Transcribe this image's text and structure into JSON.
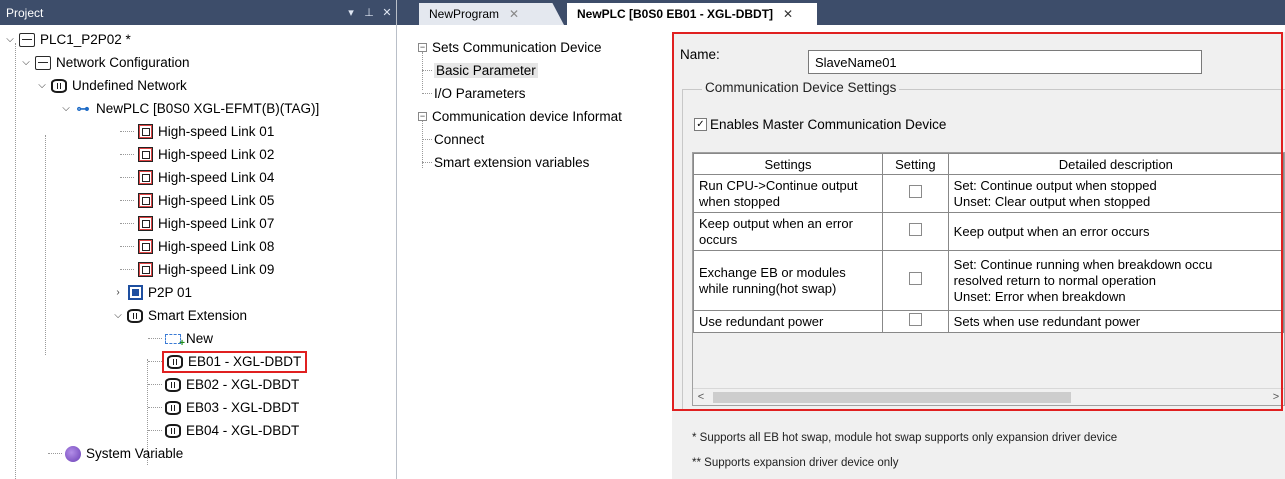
{
  "project_panel": {
    "title": "Project",
    "buttons": [
      "▾",
      "ᵖ",
      "✕"
    ],
    "tree": [
      {
        "label": "PLC1_P2P02 *"
      },
      {
        "label": "Network Configuration"
      },
      {
        "label": "Undefined Network"
      },
      {
        "label": "NewPLC [B0S0 XGL-EFMT(B)(TAG)]"
      },
      {
        "label": "High-speed Link 01"
      },
      {
        "label": "High-speed Link 02"
      },
      {
        "label": "High-speed Link 04"
      },
      {
        "label": "High-speed Link 05"
      },
      {
        "label": "High-speed Link 07"
      },
      {
        "label": "High-speed Link 08"
      },
      {
        "label": "High-speed Link 09"
      },
      {
        "label": "P2P 01"
      },
      {
        "label": "Smart Extension"
      },
      {
        "label": "New"
      },
      {
        "label": "EB01 - XGL-DBDT"
      },
      {
        "label": "EB02 - XGL-DBDT"
      },
      {
        "label": "EB03 - XGL-DBDT"
      },
      {
        "label": "EB04 - XGL-DBDT"
      },
      {
        "label": "System Variable"
      }
    ]
  },
  "tabs": [
    {
      "label": "NewProgram",
      "close": "✕"
    },
    {
      "label": "NewPLC [B0S0 EB01 - XGL-DBDT]",
      "close": "✕"
    }
  ],
  "settings_tree": [
    {
      "label": "Sets Communication Device"
    },
    {
      "label": "Basic Parameter"
    },
    {
      "label": "I/O Parameters"
    },
    {
      "label": "Communication device Informat"
    },
    {
      "label": "Connect"
    },
    {
      "label": "Smart extension variables"
    }
  ],
  "form": {
    "name_label": "Name:",
    "name_value": "SlaveName01",
    "group_title": "Communication Device Settings",
    "master_checkbox_label": "Enables Master Communication Device",
    "master_checked": true
  },
  "grid": {
    "columns": [
      "Settings",
      "Setting",
      "Detailed description"
    ],
    "rows": [
      {
        "setting": "Run CPU->Continue output when stopped",
        "checked": false,
        "desc": "Set: Continue output when stopped\nUnset: Clear output when stopped"
      },
      {
        "setting": "Keep output when an error occurs",
        "checked": false,
        "desc": "Keep output when an error occurs"
      },
      {
        "setting": "Exchange EB or modules while running(hot swap)",
        "checked": false,
        "desc": "Set: Continue running when breakdown occu\nresolved return to normal operation\nUnset: Error when breakdown"
      },
      {
        "setting": "Use redundant power",
        "checked": false,
        "desc": "Sets when use redundant power"
      }
    ]
  },
  "footnotes": [
    "* Supports all EB hot swap, module hot swap supports only expansion driver device",
    "** Supports expansion driver device only"
  ],
  "colors": {
    "panel_header": "#3d4d6a",
    "highlight": "#e02020"
  }
}
